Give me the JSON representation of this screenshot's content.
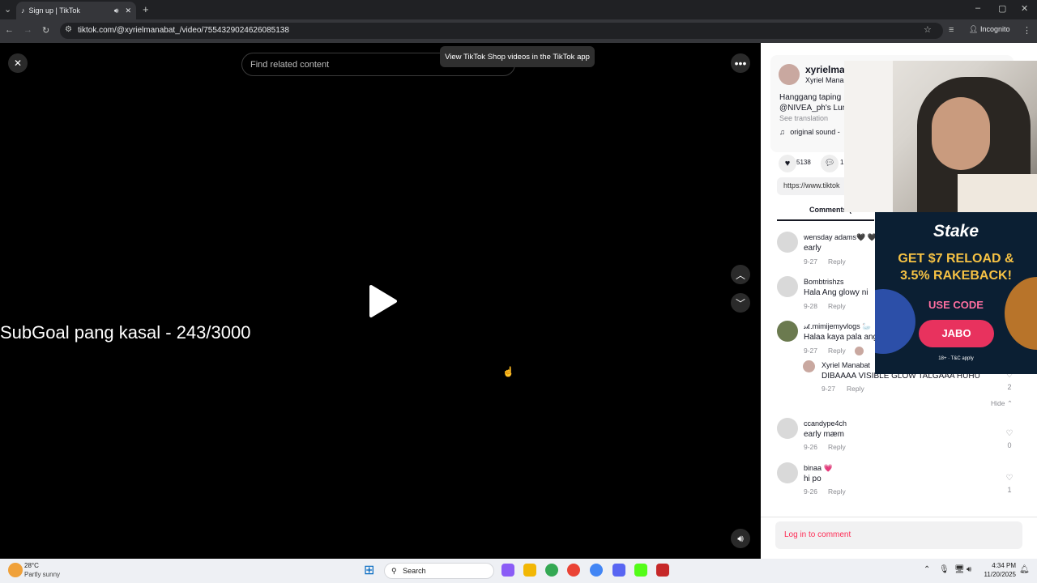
{
  "browser": {
    "tab_title": "Sign up | TikTok",
    "url": "tiktok.com/@xyrielmanabat_/video/7554329024626085138",
    "incognito_label": "Incognito"
  },
  "video": {
    "search_placeholder": "Find related content",
    "shop_tooltip": "View TikTok Shop videos in the TikTok app",
    "overlay_text": "SubGoal pang kasal - 243/3000"
  },
  "author": {
    "username": "xyrielma",
    "display_name": "Xyriel Mana",
    "caption_line1": "Hanggang taping",
    "caption_line2": "@NIVEA_ph's Lum",
    "see_translation": "See translation",
    "sound": "original sound -",
    "likes": "5138",
    "comments_count": "1",
    "link": "https://www.tiktok",
    "comments_tab": "Comments (4"
  },
  "comments": [
    {
      "name": "wensday adams🖤 🖤",
      "text": "early",
      "date": "9-27",
      "reply": "Reply",
      "likes": ""
    },
    {
      "name": "Bombtrishzs",
      "text": "Hala Ang glowy ni",
      "date": "9-28",
      "reply": "Reply",
      "likes": ""
    },
    {
      "name": "𝓈𝓀.mimijemyvlogs 🦢",
      "text": "Halaa kaya pala ang",
      "date": "9-27",
      "reply": "Reply",
      "likes": ""
    },
    {
      "name": "ccandype4ch",
      "text": "early mæm",
      "date": "9-26",
      "reply": "Reply",
      "likes": "0"
    },
    {
      "name": "binaa 💗",
      "text": "hi po",
      "date": "9-26",
      "reply": "Reply",
      "likes": "1"
    }
  ],
  "reply": {
    "name": "Xyriel Manabat",
    "text": "DIBAAAA VISIBLE GLOW TALGAAA HUHU",
    "date": "9-27",
    "reply": "Reply",
    "likes": "2",
    "hide": "Hide"
  },
  "login_prompt": "Log in to comment",
  "ad": {
    "brand": "Stake",
    "headline1": "GET $7 RELOAD &",
    "headline2": "3.5% RAKEBACK!",
    "use_code": "USE CODE",
    "code": "JABO",
    "disclaimer": "18+ · T&C apply"
  },
  "taskbar": {
    "temp": "28°C",
    "weather": "Partly sunny",
    "search": "Search",
    "time": "4:34 PM",
    "date": "11/20/2025"
  }
}
